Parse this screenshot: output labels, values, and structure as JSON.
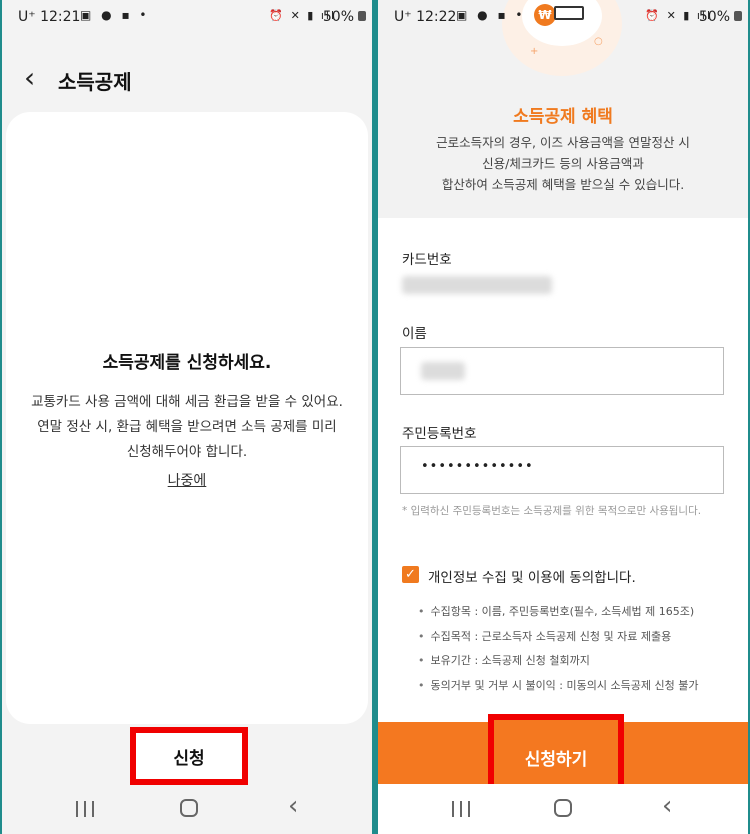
{
  "left": {
    "status": {
      "time": "12:21",
      "carrier": "U⁺",
      "battery": "50%"
    },
    "header": {
      "back_icon": "chevron-left-icon",
      "title": "소득공제"
    },
    "prompt": {
      "title": "소득공제를 신청하세요.",
      "desc_line1": "교통카드 사용 금액에 대해 세금 환급을 받을 수 있어요.",
      "desc_line2": "연말 정산 시, 환급 혜택을 받으려면 소득 공제를 미리",
      "desc_line3": "신청해두어야 합니다.",
      "later": "나중에"
    },
    "apply_button": "신청"
  },
  "right": {
    "status": {
      "time": "12:22",
      "carrier": "U⁺",
      "battery": "50%"
    },
    "benefit": {
      "currency_symbol": "₩",
      "title": "소득공제 혜택",
      "line1": "근로소득자의 경우, 이즈 사용금액을 연말정산 시",
      "line2": "신용/체크카드 등의 사용금액과",
      "line3": "합산하여 소득공제 혜택을 받으실 수 있습니다."
    },
    "form": {
      "card_label": "카드번호",
      "name_label": "이름",
      "rrn_label": "주민등록번호",
      "rrn_value": "•••••••••••••",
      "note": "* 입력하신 주민등록번호는 소득공제를 위한 목적으로만 사용됩니다."
    },
    "consent": {
      "checked": true,
      "label": "개인정보 수집 및 이용에 동의합니다.",
      "items": [
        "수집항목 : 이름, 주민등록번호(필수, 소득세법 제 165조)",
        "수집목적 : 근로소득자 소득공제 신청 및 자료 제출용",
        "보유기간 : 소득공제 신청 철회까지",
        "동의거부 및 거부 시 불이익 : 미동의시 소득공제 신청 불가"
      ]
    },
    "apply_button": "신청하기"
  },
  "colors": {
    "accent": "#f47820",
    "highlight_box": "#f00000"
  }
}
